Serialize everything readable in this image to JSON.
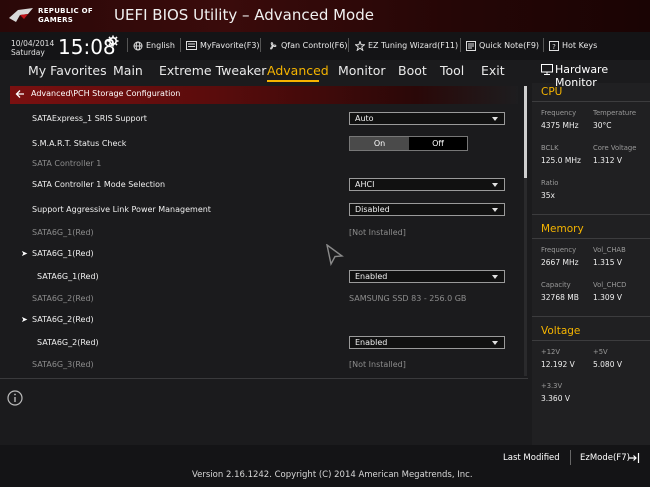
{
  "header": {
    "brand_line1": "REPUBLIC OF",
    "brand_line2": "GAMERS",
    "app_title": "UEFI BIOS Utility – Advanced Mode"
  },
  "infobar": {
    "date": "10/04/2014",
    "day": "Saturday",
    "time": "15:08",
    "language": "English",
    "my_favorite": "MyFavorite(F3)",
    "qfan": "Qfan Control(F6)",
    "ez_tuning": "EZ Tuning Wizard(F11)",
    "quick_note": "Quick Note(F9)",
    "hot_keys": "Hot Keys"
  },
  "menu": {
    "items": [
      "My Favorites",
      "Main",
      "Extreme Tweaker",
      "Advanced",
      "Monitor",
      "Boot",
      "Tool",
      "Exit"
    ],
    "active": "Advanced"
  },
  "breadcrumb": "Advanced\\PCH Storage Configuration",
  "settings": {
    "sata_express_label": "SATAExpress_1 SRIS Support",
    "sata_express_value": "Auto",
    "smart_label": "S.M.A.R.T. Status Check",
    "smart_on": "On",
    "smart_off": "Off",
    "controller_label": "SATA Controller 1",
    "controller_mode_label": "SATA Controller 1 Mode Selection",
    "controller_mode_value": "AHCI",
    "alpm_label": "Support Aggressive Link Power Management",
    "alpm_value": "Disabled",
    "port1_info_label": "SATA6G_1(Red)",
    "port1_info_value": "[Not Installed]",
    "port1_expand_label": "SATA6G_1(Red)",
    "port1_sub_label": "SATA6G_1(Red)",
    "port1_sub_value": "Enabled",
    "port2_info_label": "SATA6G_2(Red)",
    "port2_info_value": "SAMSUNG SSD 83 - 256.0 GB",
    "port2_expand_label": "SATA6G_2(Red)",
    "port2_sub_label": "SATA6G_2(Red)",
    "port2_sub_value": "Enabled",
    "port3_info_label": "SATA6G_3(Red)",
    "port3_info_value": "[Not Installed]"
  },
  "footer": {
    "last_modified": "Last Modified",
    "ezmode": "EzMode(F7)",
    "copyright": "Version 2.16.1242. Copyright (C) 2014 American Megatrends, Inc."
  },
  "hardware_monitor": {
    "title": "Hardware Monitor",
    "cpu": {
      "title": "CPU",
      "frequency_label": "Frequency",
      "frequency": "4375 MHz",
      "temperature_label": "Temperature",
      "temperature": "30°C",
      "bclk_label": "BCLK",
      "bclk": "125.0 MHz",
      "core_voltage_label": "Core Voltage",
      "core_voltage": "1.312 V",
      "ratio_label": "Ratio",
      "ratio": "35x"
    },
    "memory": {
      "title": "Memory",
      "frequency_label": "Frequency",
      "frequency": "2667 MHz",
      "vol_chab_label": "Vol_CHAB",
      "vol_chab": "1.315 V",
      "capacity_label": "Capacity",
      "capacity": "32768 MB",
      "vol_chcd_label": "Vol_CHCD",
      "vol_chcd": "1.309 V"
    },
    "voltage": {
      "title": "Voltage",
      "v12_label": "+12V",
      "v12": "12.192 V",
      "v5_label": "+5V",
      "v5": "5.080 V",
      "v33_label": "+3.3V",
      "v33": "3.360 V"
    }
  },
  "colors": {
    "accent": "#f5b400",
    "title_red": "#7a1010"
  }
}
